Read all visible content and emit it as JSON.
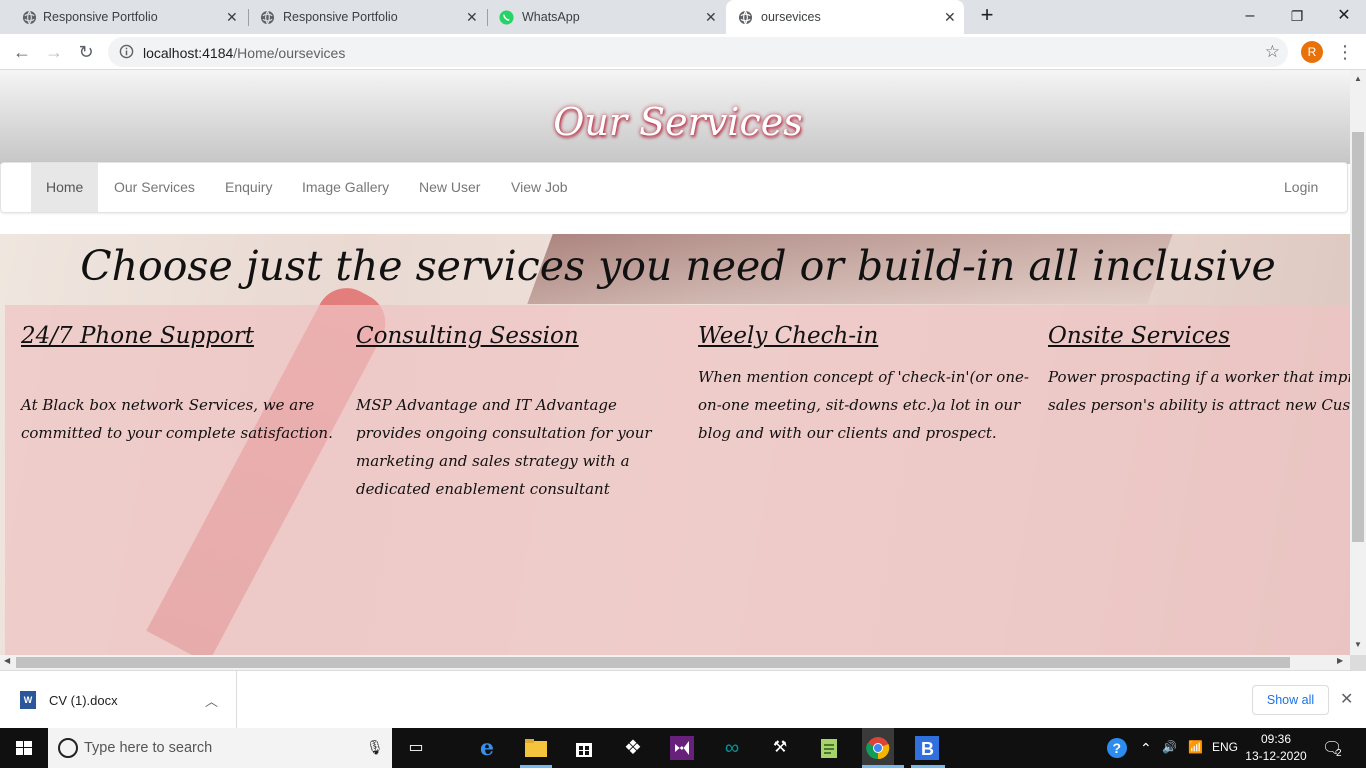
{
  "browser": {
    "tabs": [
      {
        "title": "Responsive Portfolio",
        "favicon": "globe-icon"
      },
      {
        "title": "Responsive Portfolio",
        "favicon": "globe-icon"
      },
      {
        "title": "WhatsApp",
        "favicon": "whatsapp-icon"
      },
      {
        "title": "oursevices",
        "favicon": "globe-icon",
        "active": true
      }
    ],
    "url_host": "localhost:4184",
    "url_path": "/Home/oursevices",
    "profile_initial": "R",
    "profile_color": "#e8710a"
  },
  "site": {
    "header_title": "Our Services",
    "nav": {
      "items": [
        "Home",
        "Our Services",
        "Enquiry",
        "Image Gallery",
        "New User",
        "View Job"
      ],
      "active_index": 0,
      "login": "Login"
    },
    "hero_heading": "Choose just the services you need or build-in all inclusive",
    "services": [
      {
        "title": "24/7 Phone Support",
        "lines": [
          "",
          "At Black box network Services, we are",
          "committed to your complete satisfaction."
        ]
      },
      {
        "title": "Consulting Session",
        "lines": [
          "",
          "MSP Advantage and IT Advantage",
          "provides ongoing consultation for your",
          "marketing and sales strategy with a",
          "dedicated enablement consultant"
        ]
      },
      {
        "title": "Weely Chech-in",
        "lines": [
          "When mention concept of 'check-in'(or one-",
          "on-one meeting, sit-downs etc.)a lot in our",
          "blog and with our clients and prospect."
        ]
      },
      {
        "title": "Onsite Services",
        "lines": [
          "Power prospacting if a worker that improv",
          "sales person's ability is attract new Custom"
        ]
      }
    ]
  },
  "downloads": {
    "file_name": "CV (1).docx",
    "show_all": "Show all"
  },
  "taskbar": {
    "search_placeholder": "Type here to search",
    "language": "ENG",
    "time": "09:36",
    "date": "13-12-2020",
    "notification_count": "2"
  }
}
